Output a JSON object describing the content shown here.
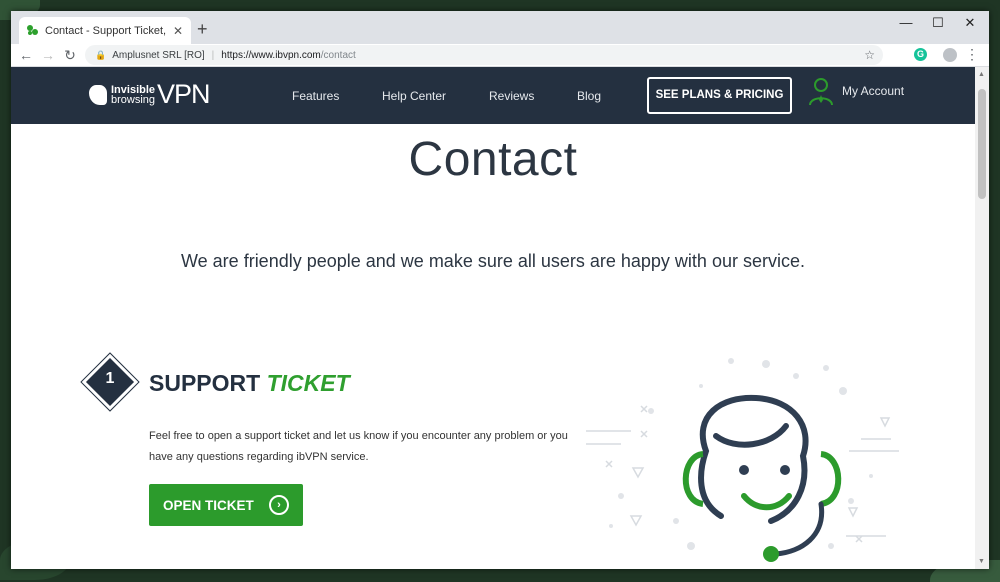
{
  "browser": {
    "tab_title": "Contact - Support Ticket, Email, L",
    "new_tab": "+",
    "minimize": "—",
    "maximize": "☐",
    "close": "✕",
    "site_identity": "Amplusnet SRL [RO]",
    "url_host": "https://www.ibvpn.com",
    "url_path": "/contact",
    "extension_letter": "G"
  },
  "site": {
    "logo_line1": "Invisible",
    "logo_line2": "browsing",
    "logo_vpn": "VPN",
    "nav": [
      "Features",
      "Help Center",
      "Reviews",
      "Blog"
    ],
    "plans_button": "SEE PLANS & PRICING",
    "account": "My Account"
  },
  "content": {
    "heading": "Contact",
    "intro": "We are friendly people and we make sure all users are happy with our service.",
    "step_number": "1",
    "support_title": "SUPPORT",
    "support_title_accent": "TICKET",
    "support_desc": "Feel free to open a support ticket and let us know if you encounter any problem or you have any questions regarding ibVPN service.",
    "open_ticket": "OPEN TICKET",
    "open_ticket_arrow": "›"
  },
  "colors": {
    "nav_bg": "#243040",
    "accent_green": "#2c9b2c",
    "text_dark": "#2c3642"
  }
}
